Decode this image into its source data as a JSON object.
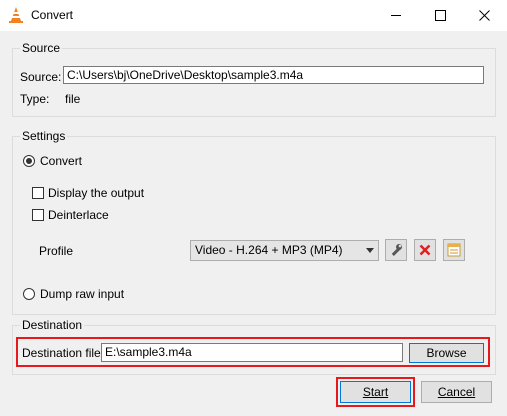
{
  "window": {
    "title": "Convert",
    "controls": [
      "minimize-icon",
      "maximize-icon",
      "close-icon"
    ]
  },
  "source": {
    "group_label": "Source",
    "source_label": "Source:",
    "source_value": "C:\\Users\\bj\\OneDrive\\Desktop\\sample3.m4a",
    "type_label": "Type:",
    "type_value": "file"
  },
  "settings": {
    "group_label": "Settings",
    "convert_label": "Convert",
    "convert_selected": true,
    "display_output_label": "Display the output",
    "display_output_checked": false,
    "deinterlace_label": "Deinterlace",
    "deinterlace_checked": false,
    "profile_label": "Profile",
    "profile_value": "Video - H.264 + MP3 (MP4)",
    "profile_tools": [
      "wrench-icon",
      "delete-icon",
      "new-profile-icon"
    ],
    "dump_raw_label": "Dump raw input",
    "dump_raw_selected": false
  },
  "destination": {
    "group_label": "Destination",
    "file_label": "Destination file:",
    "file_value": "E:\\sample3.m4a",
    "browse_label": "Browse"
  },
  "footer": {
    "start_label": "Start",
    "cancel_label": "Cancel"
  },
  "colors": {
    "highlight": "#e8191c",
    "focus_border": "#0078d7",
    "window_bg": "#f0f0f0"
  }
}
